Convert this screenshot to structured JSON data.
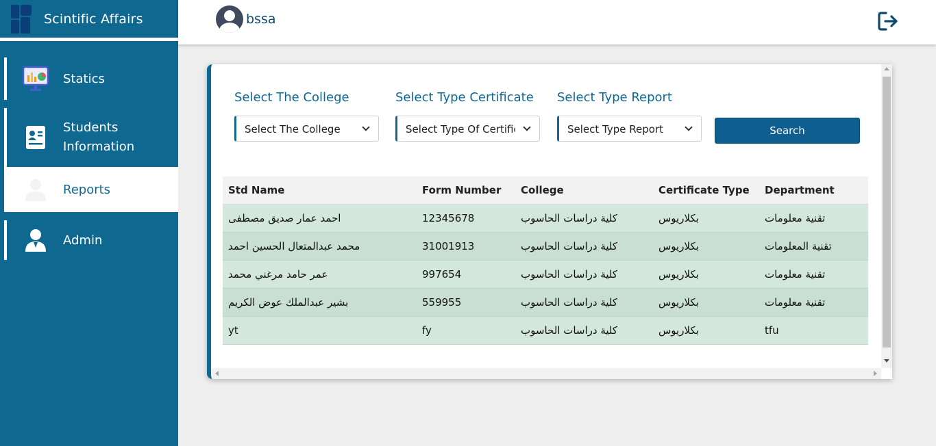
{
  "app": {
    "title": "Scintific Affairs"
  },
  "sidebar": {
    "items": [
      {
        "label": "Statics",
        "icon": "presentation-chart-icon",
        "active": false
      },
      {
        "label": "Students Information",
        "icon": "id-card-icon",
        "active": false
      },
      {
        "label": "Reports",
        "icon": "user-icon",
        "active": true
      },
      {
        "label": "Admin",
        "icon": "admin-user-icon",
        "active": false
      }
    ]
  },
  "header": {
    "username": "bssa",
    "logout_icon": "logout-icon"
  },
  "filters": {
    "college": {
      "label": "Select The College",
      "value": "Select The College"
    },
    "certificate": {
      "label": "Select Type Certificate",
      "value": "Select Type Of Certificate"
    },
    "report": {
      "label": "Select Type Report",
      "value": "Select Type Report"
    },
    "search_label": "Search"
  },
  "table": {
    "columns": [
      "Std Name",
      "Form Number",
      "College",
      "Certificate Type",
      "Department"
    ],
    "rows": [
      [
        "احمد عمار صديق مصطفى",
        "12345678",
        "كلية دراسات الحاسوب",
        "بكلاريوس",
        "تقنية معلومات"
      ],
      [
        "محمد عبدالمتعال الحسين احمد",
        "31001913",
        "كلية دراسات الحاسوب",
        "بكلاريوس",
        "تقنية المعلومات"
      ],
      [
        "عمر حامد مرغني محمد",
        "997654",
        "كلية دراسات الحاسوب",
        "بكلاريوس",
        "تقنية معلومات"
      ],
      [
        "بشير عبدالملك عوض الكريم",
        "559955",
        "كلية دراسات الحاسوب",
        "بكلاريوس",
        "تقنية معلومات"
      ],
      [
        "yt",
        "fy",
        "كلية دراسات الحاسوب",
        "بكلاريوس",
        "tfu"
      ]
    ]
  },
  "colors": {
    "primary": "#0e6890",
    "row_odd": "#d3e7dc",
    "row_even": "#c9dfd3"
  }
}
